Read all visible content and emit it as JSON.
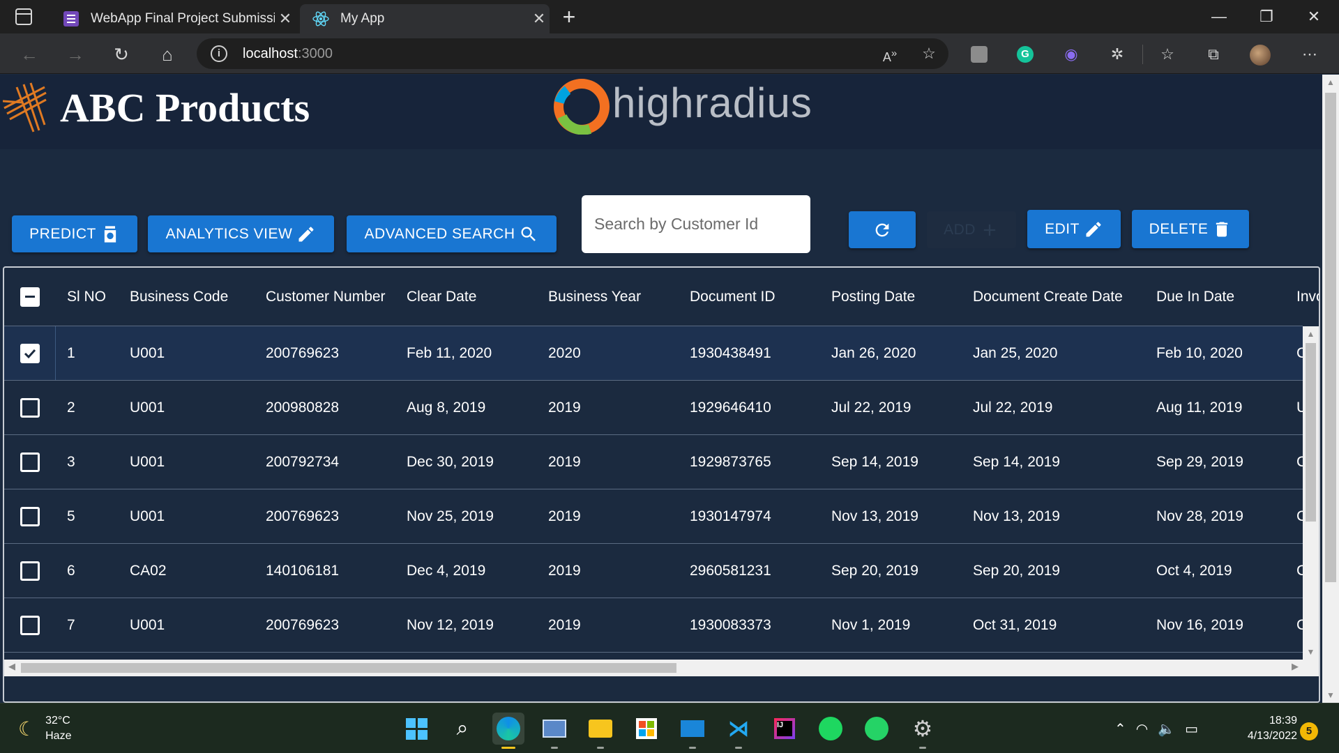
{
  "browser": {
    "tabs": [
      {
        "title": "WebApp Final Project Submission",
        "icon": "forms-icon",
        "active": false
      },
      {
        "title": "My App",
        "icon": "react-icon",
        "active": true
      }
    ],
    "address": {
      "host": "localhost",
      "port": ":3000"
    }
  },
  "app": {
    "title": "ABC Products",
    "partner_logo_text": "highradius",
    "buttons": {
      "predict": "PREDICT",
      "analytics": "ANALYTICS VIEW",
      "advanced_search": "ADVANCED SEARCH",
      "add": "ADD",
      "edit": "EDIT",
      "delete": "DELETE"
    },
    "search": {
      "placeholder": "Search by Customer Id",
      "value": ""
    },
    "grid": {
      "columns": [
        "Sl NO",
        "Business Code",
        "Customer Number",
        "Clear Date",
        "Business Year",
        "Document ID",
        "Posting Date",
        "Document Create Date",
        "Due In Date",
        "Invo"
      ],
      "rows": [
        {
          "checked": true,
          "cells": [
            "1",
            "U001",
            "200769623",
            "Feb 11, 2020",
            "2020",
            "1930438491",
            "Jan 26, 2020",
            "Jan 25, 2020",
            "Feb 10, 2020",
            "C"
          ]
        },
        {
          "checked": false,
          "cells": [
            "2",
            "U001",
            "200980828",
            "Aug 8, 2019",
            "2019",
            "1929646410",
            "Jul 22, 2019",
            "Jul 22, 2019",
            "Aug 11, 2019",
            "U"
          ]
        },
        {
          "checked": false,
          "cells": [
            "3",
            "U001",
            "200792734",
            "Dec 30, 2019",
            "2019",
            "1929873765",
            "Sep 14, 2019",
            "Sep 14, 2019",
            "Sep 29, 2019",
            "C"
          ]
        },
        {
          "checked": false,
          "cells": [
            "5",
            "U001",
            "200769623",
            "Nov 25, 2019",
            "2019",
            "1930147974",
            "Nov 13, 2019",
            "Nov 13, 2019",
            "Nov 28, 2019",
            "C"
          ]
        },
        {
          "checked": false,
          "cells": [
            "6",
            "CA02",
            "140106181",
            "Dec 4, 2019",
            "2019",
            "2960581231",
            "Sep 20, 2019",
            "Sep 20, 2019",
            "Oct 4, 2019",
            "C"
          ]
        },
        {
          "checked": false,
          "cells": [
            "7",
            "U001",
            "200769623",
            "Nov 12, 2019",
            "2019",
            "1930083373",
            "Nov 1, 2019",
            "Oct 31, 2019",
            "Nov 16, 2019",
            "C"
          ]
        }
      ]
    }
  },
  "taskbar": {
    "weather": {
      "temp": "32°C",
      "condition": "Haze"
    },
    "clock": {
      "time": "18:39",
      "date": "4/13/2022"
    },
    "notification_count": "5",
    "apps": [
      "windows-start-icon",
      "search-icon",
      "edge-icon",
      "photos-icon",
      "file-explorer-icon",
      "store-icon",
      "mail-icon",
      "vscode-icon",
      "intellij-icon",
      "spotify-icon",
      "whatsapp-icon",
      "settings-icon"
    ]
  },
  "colors": {
    "accent": "#1976d2",
    "page_bg": "#1b2a3f",
    "header_bg": "#17243a"
  }
}
